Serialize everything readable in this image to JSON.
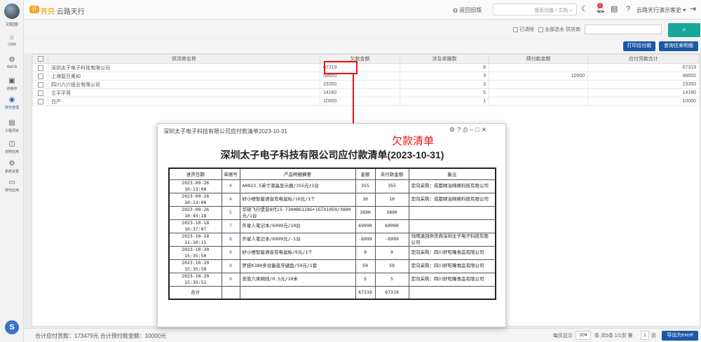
{
  "sidebar": {
    "user_name": "刘晓丽",
    "items": [
      {
        "label": "CRM",
        "icon": "crm-icon"
      },
      {
        "label": "WeCA",
        "icon": "weca-icon"
      },
      {
        "label": "进销存",
        "icon": "inventory-icon"
      },
      {
        "label": "财务管理",
        "icon": "finance-icon",
        "active": true
      },
      {
        "label": "工程项目",
        "icon": "project-icon"
      },
      {
        "label": "定制应用",
        "icon": "custom-app-icon"
      },
      {
        "label": "系统设置",
        "icon": "settings-icon"
      },
      {
        "label": "现代应用",
        "icon": "modern-app-icon"
      }
    ]
  },
  "header": {
    "brand_badge": "开",
    "brand_a": "开只",
    "brand_b": "云路天行",
    "back_link": "返回旧版",
    "search_placeholder": "搜索功能 / 文档",
    "notification_count": "2",
    "account": "云路天行演示客史"
  },
  "filters": {
    "option1": "已清除",
    "option2": "全部选水 供货商",
    "search_icon": "search-icon"
  },
  "actions": {
    "print_label": "打印应付款",
    "query_label": "查询往来明细"
  },
  "grid": {
    "headers": [
      "",
      "供货商名称",
      "欠款金额",
      "涉及单据数",
      "预付款金额",
      "应付货款合计"
    ],
    "rows": [
      {
        "name": "深圳太子电子科技有限公司",
        "owed": "67319",
        "docs": "8",
        "prepay": "",
        "total": "67319"
      },
      {
        "name": "上海复旦奥如",
        "owed": "58650",
        "docs": "3",
        "prepay": "10000",
        "total": "48650"
      },
      {
        "name": "四川六六纸业有限公司",
        "owed": "23350",
        "docs": "3",
        "prepay": "",
        "total": "23350"
      },
      {
        "name": "立平平哥",
        "owed": "14160",
        "docs": "5",
        "prepay": "",
        "total": "14160"
      },
      {
        "name": "白产",
        "owed": "10000",
        "docs": "1",
        "prepay": "",
        "total": "10000"
      }
    ]
  },
  "footer": {
    "summary": "合计应付货款：173479元  合计预付款金额：10000元",
    "per_page_label": "每页显示",
    "per_page": "30",
    "page_info_a": "条 共5条 1/1页 第",
    "page": "1",
    "page_info_b": "页",
    "export": "导出为excel"
  },
  "annotation": {
    "note": "欠款清单"
  },
  "modal": {
    "title": "深圳太子电子科技有限公司应付款清单2023-10-31",
    "doc_title": "深圳太子电子科技有限公司应付款清单(2023-10-31)",
    "headers": [
      "进货日期",
      "单据号",
      "产品明细摘要",
      "金额",
      "未付款金额",
      "备注"
    ],
    "rows": [
      {
        "date": "2023-09-26 10:13:08",
        "no": "4",
        "summary": "A0023.5英寸液晶显示器/355元/1台",
        "amount": "355",
        "unpaid": "355",
        "note": "定向采购：成都顺治网络科技有限公司"
      },
      {
        "date": "2023-09-26 10:13:08",
        "no": "4",
        "summary": "好小橙智能语音充电鼠标/10元/1个",
        "amount": "10",
        "unpaid": "10",
        "note": "定向采购：成都顺治网络科技有限公司"
      },
      {
        "date": "2023-09-26 10:45:18",
        "no": "5",
        "summary": "华硕飞行堡垒8代i5-7300BG128G+1GTX1050/3890元/1台",
        "amount": "3890",
        "unpaid": "3890",
        "note": ""
      },
      {
        "date": "2023-10-18 10:37:07",
        "no": "7",
        "summary": "外星人笔记本/6999元/10台",
        "amount": "69990",
        "unpaid": "69990",
        "note": ""
      },
      {
        "date": "2023-10-18 11:10:11",
        "no": "8",
        "summary": "外星人笔记本/6999元/-1台",
        "amount": "-6999",
        "unpaid": "-6999",
        "note": "领用退回供货商深圳太子电子科技有限公司"
      },
      {
        "date": "2023-10-20 15:35:50",
        "no": "9",
        "summary": "好小橙智能语音充电鼠标/9元/1个",
        "amount": "9",
        "unpaid": "9",
        "note": "定向采购：四川好吃嘴食品有限公司"
      },
      {
        "date": "2023-10-20 15:35:50",
        "no": "9",
        "summary": "罗技K380多设备蓝牙键盘/59元/1套",
        "amount": "59",
        "unpaid": "59",
        "note": "定向采购：四川好吃嘴食品有限公司"
      },
      {
        "date": "2023-10-20 15:35:51",
        "no": "9",
        "summary": "安普六类网线/0.5元/10米",
        "amount": "5",
        "unpaid": "5",
        "note": "定向采购：四川好吃嘴食品有限公司"
      }
    ],
    "total_label": "合计",
    "total_amount": "67319",
    "total_unpaid": "67319"
  }
}
